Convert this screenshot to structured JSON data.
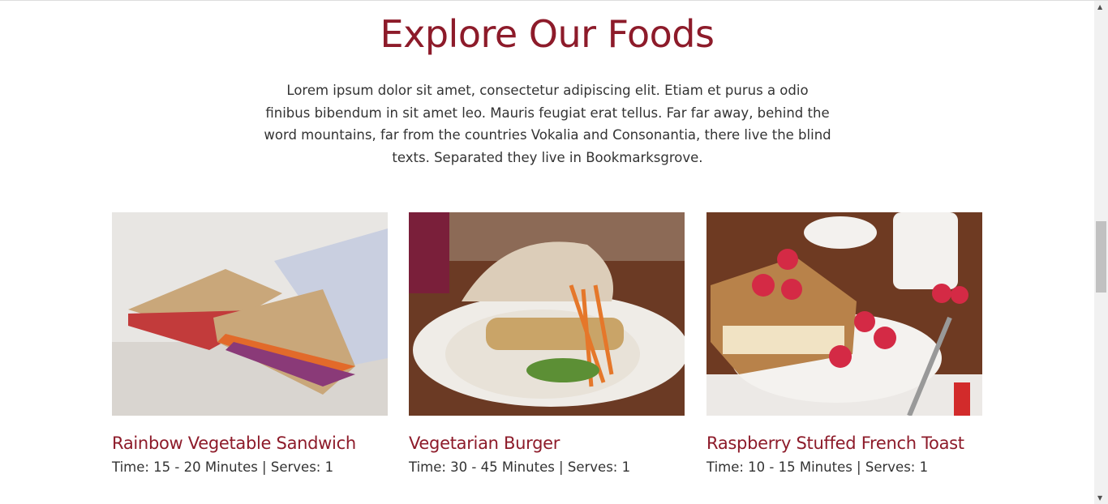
{
  "section": {
    "title": "Explore Our Foods",
    "intro": "Lorem ipsum dolor sit amet, consectetur adipiscing elit. Etiam et purus a odio finibus bibendum in sit amet leo. Mauris feugiat erat tellus. Far far away, behind the word mountains, far from the countries Vokalia and Consonantia, there live the blind texts. Separated they live in Bookmarksgrove."
  },
  "foods": [
    {
      "name": "Rainbow Vegetable Sandwich",
      "meta": "Time: 15 - 20 Minutes | Serves: 1"
    },
    {
      "name": "Vegetarian Burger",
      "meta": "Time: 30 - 45 Minutes | Serves: 1"
    },
    {
      "name": "Raspberry Stuffed French Toast",
      "meta": "Time: 10 - 15 Minutes | Serves: 1"
    }
  ],
  "colors": {
    "accent": "#8d1b2a",
    "text": "#333333"
  }
}
